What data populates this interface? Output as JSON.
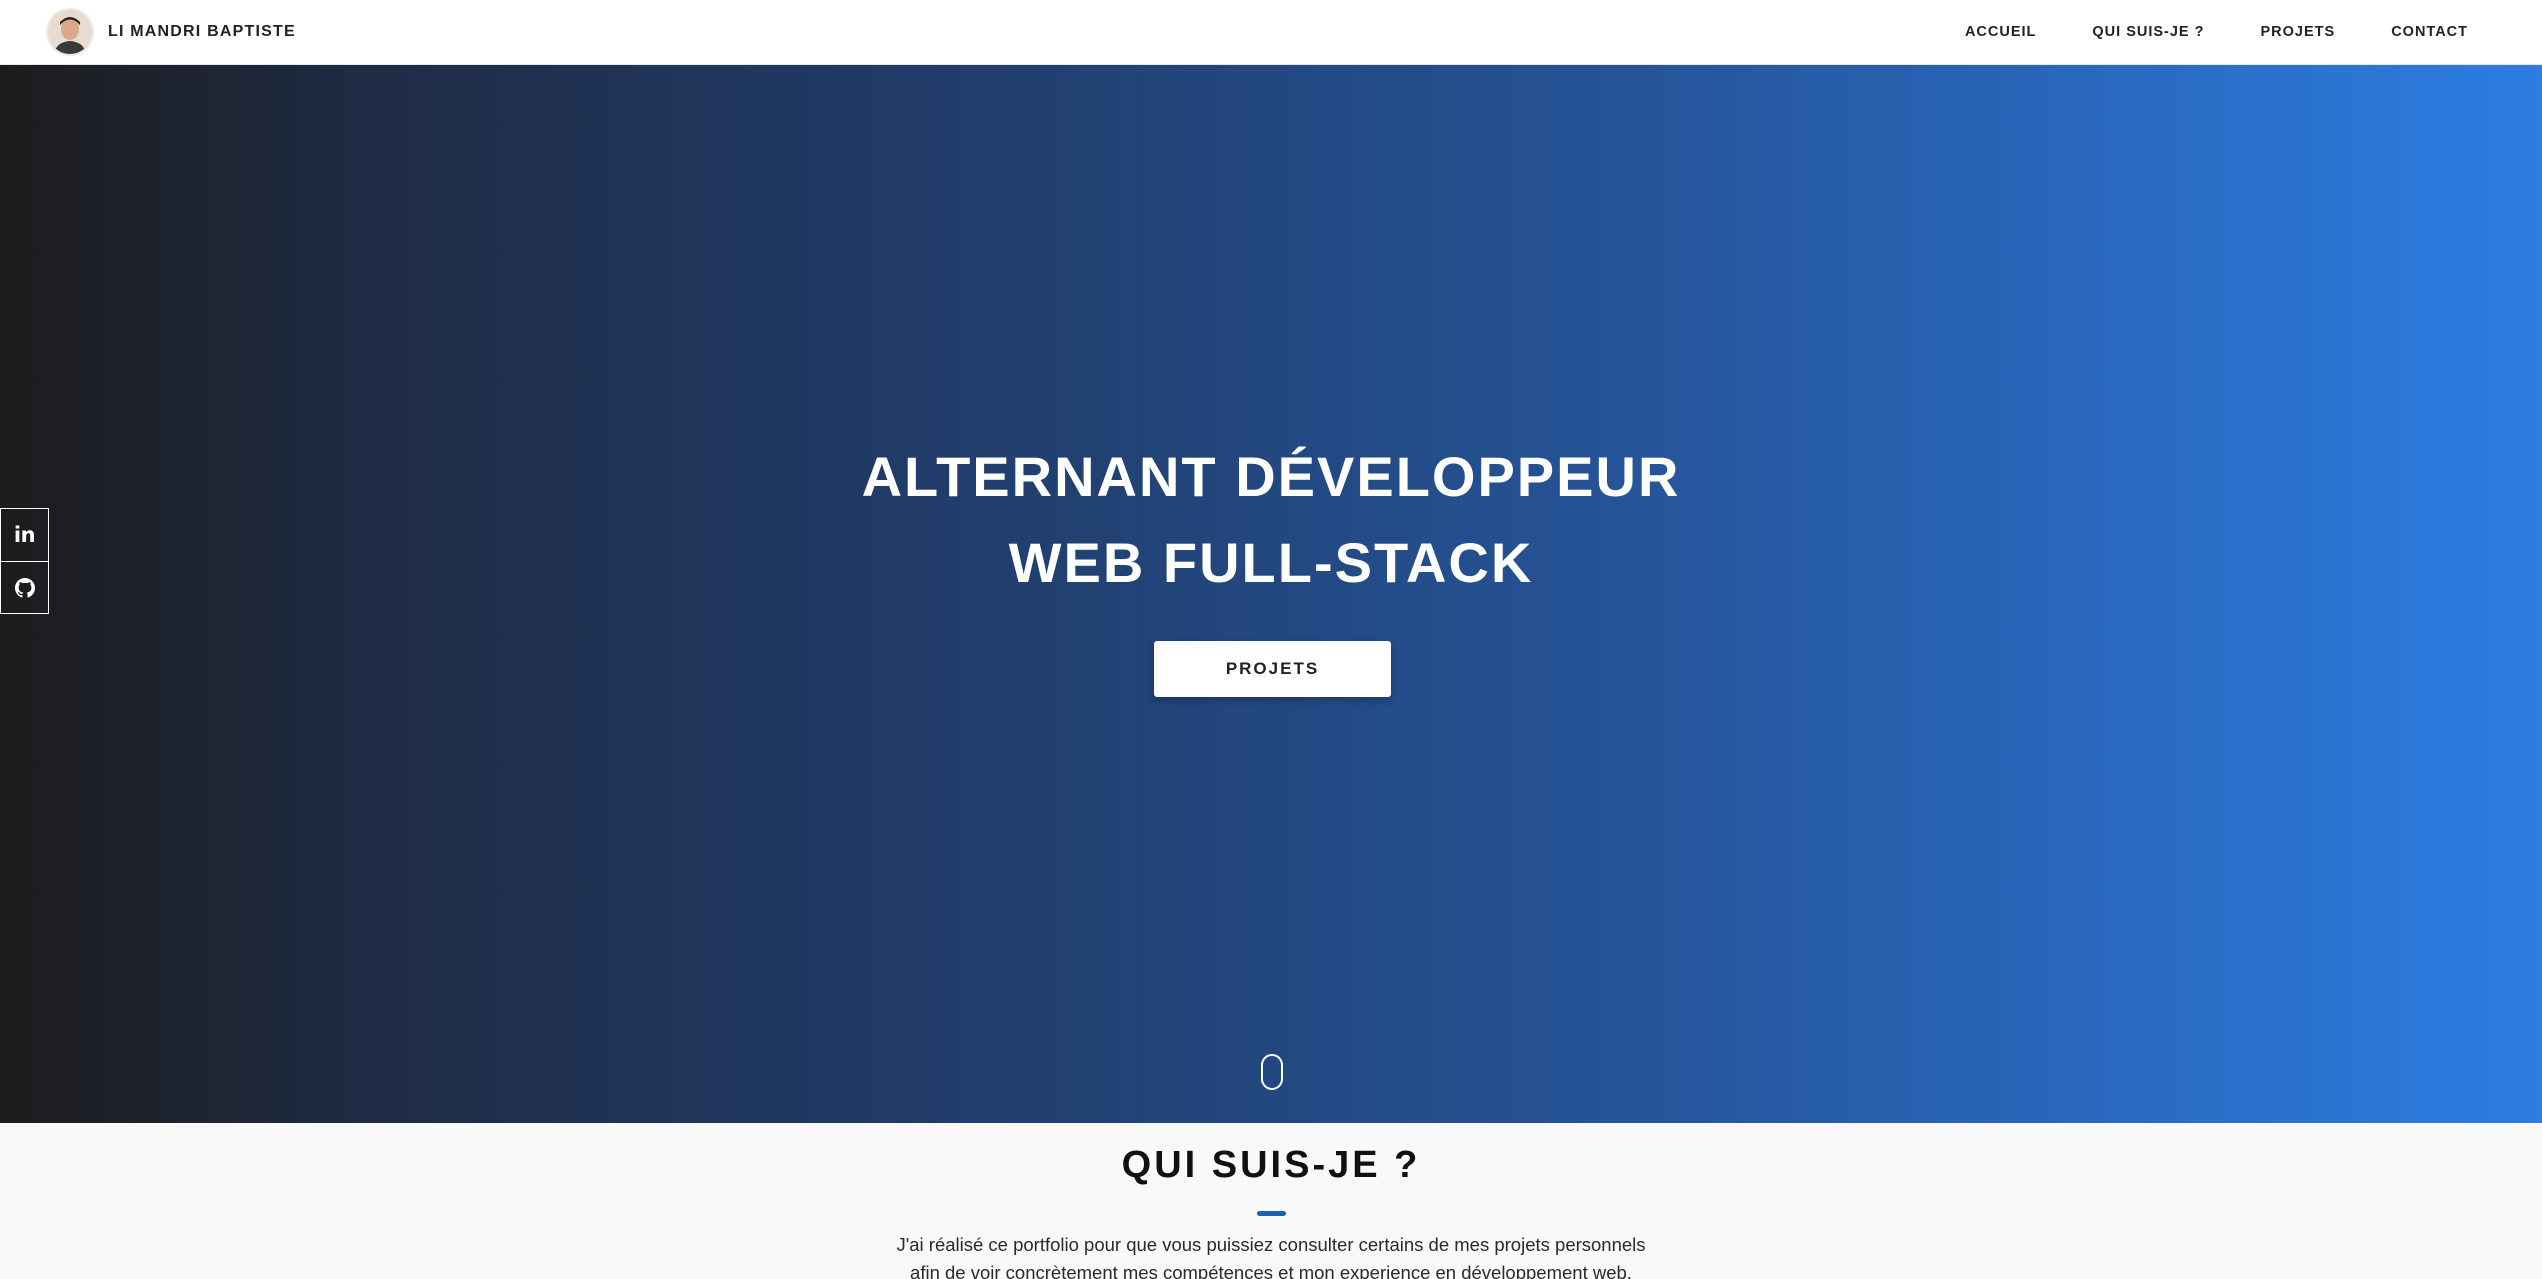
{
  "header": {
    "brand_name": "LI MANDRI BAPTISTE",
    "nav": [
      "ACCUEIL",
      "QUI SUIS-JE ?",
      "PROJETS",
      "CONTACT"
    ]
  },
  "hero": {
    "title_line1": "ALTERNANT DÉVELOPPEUR",
    "title_line2": "WEB FULL-STACK",
    "button_label": "PROJETS"
  },
  "social": {
    "linkedin_label": "in",
    "icons": [
      "linkedin-icon",
      "github-icon"
    ]
  },
  "about": {
    "title": "QUI SUIS-JE ?",
    "text": "J'ai réalisé ce portfolio pour que vous puissiez consulter certains de mes projets personnels afin de voir concrètement mes compétences et mon experience en développement web."
  },
  "colors": {
    "gradient_start": "#1c1c1c",
    "gradient_end": "#2d7de3",
    "accent": "#1f5faf",
    "header_bg": "#ffffff"
  }
}
